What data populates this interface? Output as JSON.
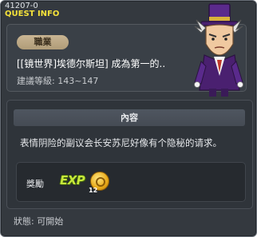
{
  "window": {
    "quest_id": "41207-0",
    "title": "QUEST INFO"
  },
  "header": {
    "job_label": "職業",
    "quest_name": "[[镜世界]埃德尔斯坦] 成為第一的..",
    "level_range": "建議等級: 143~147",
    "npc_icon": "npc-portrait"
  },
  "content": {
    "section_title": "內容",
    "description": "表情阴险的副议会长安苏尼好像有个隐秘的请求。",
    "reward_label": "獎勵",
    "exp_label": "EXP",
    "coin_icon": "gold-coin-icon",
    "coin_count": "12"
  },
  "status": {
    "text": "狀態: 可開始"
  },
  "colors": {
    "title": "#f5e23a",
    "job_badge": "#c9b593",
    "exp": "#c6e83a"
  }
}
